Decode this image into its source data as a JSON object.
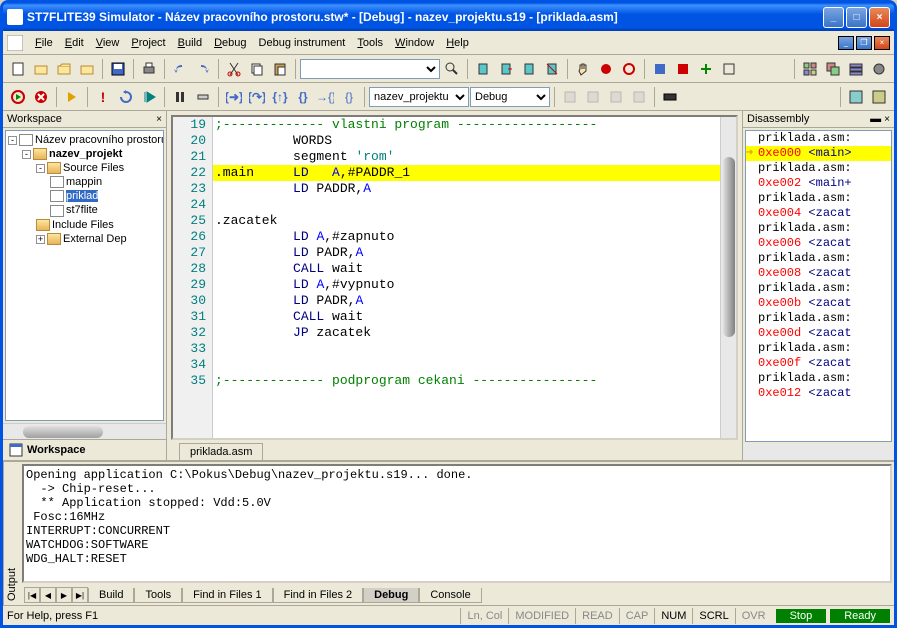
{
  "title": "ST7FLITE39 Simulator - Název pracovního prostoru.stw* - [Debug] - nazev_projektu.s19 - [priklada.asm]",
  "menu": {
    "file": "File",
    "edit": "Edit",
    "view": "View",
    "project": "Project",
    "build": "Build",
    "debug": "Debug",
    "debug_instrument": "Debug instrument",
    "tools": "Tools",
    "window": "Window",
    "help": "Help"
  },
  "toolbar2": {
    "combo1": "nazev_projektu",
    "combo2": "Debug"
  },
  "workspace": {
    "title": "Workspace",
    "root": "Název pracovního prostoru",
    "project": "nazev_projekt",
    "source_files": "Source Files",
    "files": [
      "mappin",
      "priklad",
      "st7flite"
    ],
    "include": "Include Files",
    "external": "External Dep",
    "tab": "Workspace"
  },
  "editor": {
    "file_tab": "priklada.asm",
    "lines": [
      {
        "n": 19,
        "type": "comment",
        "text": ";------------- vlastni program ------------------"
      },
      {
        "n": 20,
        "type": "code",
        "text": "          WORDS"
      },
      {
        "n": 21,
        "type": "code",
        "text": "          segment 'rom'",
        "parts": [
          {
            "t": "          segment "
          },
          {
            "t": "'rom'",
            "c": "string"
          }
        ]
      },
      {
        "n": 22,
        "type": "current",
        "text": ".main     LD   A,#PADDR_1",
        "parts": [
          {
            "t": ".main     "
          },
          {
            "t": "LD",
            "c": "keyword"
          },
          {
            "t": "   "
          },
          {
            "t": "A",
            "c": "register"
          },
          {
            "t": ",#PADDR_1"
          }
        ]
      },
      {
        "n": 23,
        "type": "code",
        "parts": [
          {
            "t": "          "
          },
          {
            "t": "LD",
            "c": "keyword"
          },
          {
            "t": " PADDR,"
          },
          {
            "t": "A",
            "c": "register"
          }
        ]
      },
      {
        "n": 24,
        "type": "code",
        "text": ""
      },
      {
        "n": 25,
        "type": "code",
        "text": ".zacatek"
      },
      {
        "n": 26,
        "type": "code",
        "parts": [
          {
            "t": "          "
          },
          {
            "t": "LD",
            "c": "keyword"
          },
          {
            "t": " "
          },
          {
            "t": "A",
            "c": "register"
          },
          {
            "t": ",#zapnuto"
          }
        ]
      },
      {
        "n": 27,
        "type": "code",
        "parts": [
          {
            "t": "          "
          },
          {
            "t": "LD",
            "c": "keyword"
          },
          {
            "t": " PADR,"
          },
          {
            "t": "A",
            "c": "register"
          }
        ]
      },
      {
        "n": 28,
        "type": "code",
        "parts": [
          {
            "t": "          "
          },
          {
            "t": "CALL",
            "c": "keyword"
          },
          {
            "t": " wait"
          }
        ]
      },
      {
        "n": 29,
        "type": "code",
        "parts": [
          {
            "t": "          "
          },
          {
            "t": "LD",
            "c": "keyword"
          },
          {
            "t": " "
          },
          {
            "t": "A",
            "c": "register"
          },
          {
            "t": ",#vypnuto"
          }
        ]
      },
      {
        "n": 30,
        "type": "code",
        "parts": [
          {
            "t": "          "
          },
          {
            "t": "LD",
            "c": "keyword"
          },
          {
            "t": " PADR,"
          },
          {
            "t": "A",
            "c": "register"
          }
        ]
      },
      {
        "n": 31,
        "type": "code",
        "parts": [
          {
            "t": "          "
          },
          {
            "t": "CALL",
            "c": "keyword"
          },
          {
            "t": " wait"
          }
        ]
      },
      {
        "n": 32,
        "type": "code",
        "parts": [
          {
            "t": "          "
          },
          {
            "t": "JP",
            "c": "keyword"
          },
          {
            "t": " zacatek"
          }
        ]
      },
      {
        "n": 33,
        "type": "code",
        "text": ""
      },
      {
        "n": 34,
        "type": "code",
        "text": ""
      },
      {
        "n": 35,
        "type": "comment",
        "text": ";------------- podprogram cekani ----------------"
      }
    ]
  },
  "disasm": {
    "title": "Disassembly",
    "lines": [
      {
        "text": "priklada.asm:",
        "current": false
      },
      {
        "addr": "0xe000",
        "sym": "<main>",
        "current": true
      },
      {
        "text": "priklada.asm:"
      },
      {
        "addr": "0xe002",
        "sym": "<main+"
      },
      {
        "text": "priklada.asm:"
      },
      {
        "addr": "0xe004",
        "sym": "<zacat"
      },
      {
        "text": "priklada.asm:"
      },
      {
        "addr": "0xe006",
        "sym": "<zacat"
      },
      {
        "text": "priklada.asm:"
      },
      {
        "addr": "0xe008",
        "sym": "<zacat"
      },
      {
        "text": "priklada.asm:"
      },
      {
        "addr": "0xe00b",
        "sym": "<zacat"
      },
      {
        "text": "priklada.asm:"
      },
      {
        "addr": "0xe00d",
        "sym": "<zacat"
      },
      {
        "text": "priklada.asm:"
      },
      {
        "addr": "0xe00f",
        "sym": "<zacat"
      },
      {
        "text": "priklada.asm:"
      },
      {
        "addr": "0xe012",
        "sym": "<zacat"
      }
    ]
  },
  "output": {
    "label": "Output",
    "text": "Opening application C:\\Pokus\\Debug\\nazev_projektu.s19... done.\n  -> Chip-reset...\n  ** Application stopped: Vdd:5.0V\n Fosc:16MHz\nINTERRUPT:CONCURRENT\nWATCHDOG:SOFTWARE\nWDG_HALT:RESET",
    "tabs": [
      "Build",
      "Tools",
      "Find in Files 1",
      "Find in Files 2",
      "Debug",
      "Console"
    ],
    "active_tab": "Debug"
  },
  "status": {
    "help": "For Help, press F1",
    "lncol": "Ln, Col",
    "modified": "MODIFIED",
    "read": "READ",
    "cap": "CAP",
    "num": "NUM",
    "scrl": "SCRL",
    "ovr": "OVR",
    "stop": "Stop",
    "ready": "Ready"
  }
}
